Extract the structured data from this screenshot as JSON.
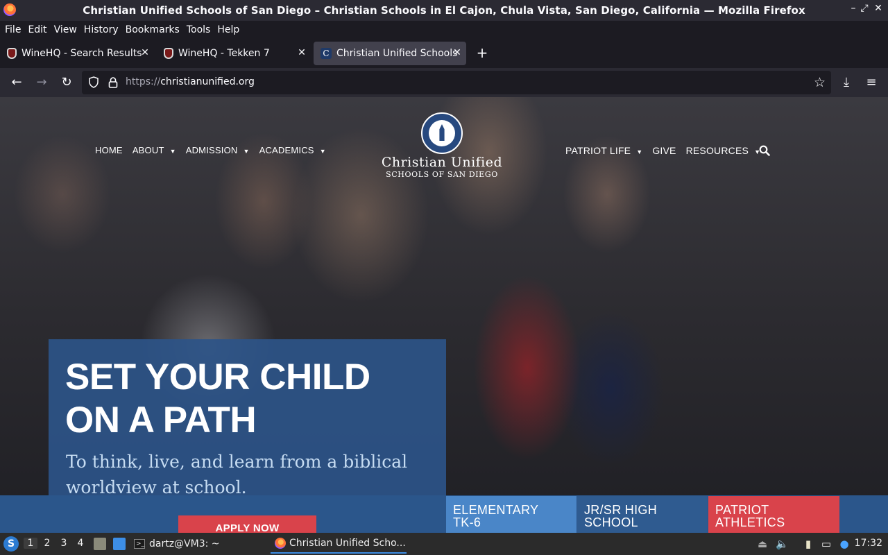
{
  "window": {
    "title": "Christian Unified Schools of San Diego – Christian Schools in El Cajon, Chula Vista, San Diego, California — Mozilla Firefox",
    "controls": [
      "–",
      "⤢",
      "✕"
    ]
  },
  "menubar": [
    "File",
    "Edit",
    "View",
    "History",
    "Bookmarks",
    "Tools",
    "Help"
  ],
  "tabs": [
    {
      "label": "WineHQ - Search Results",
      "favicon": "wine-glass-icon",
      "active": false
    },
    {
      "label": "WineHQ - Tekken 7",
      "favicon": "wine-glass-icon",
      "active": false
    },
    {
      "label": "Christian Unified Schools",
      "favicon": "c-letter-icon",
      "active": true
    }
  ],
  "newtab": "+",
  "nav": {
    "url_scheme": "https://",
    "url_host": "christianunified.org"
  },
  "site": {
    "nav_left": [
      "HOME",
      "ABOUT",
      "ADMISSION",
      "ACADEMICS"
    ],
    "nav_right": [
      "PATRIOT LIFE",
      "GIVE",
      "RESOURCES"
    ],
    "logo_name": "Christian Unified",
    "logo_sub": "SCHOOLS OF SAN DIEGO",
    "hero_title_line1": "SET YOUR CHILD",
    "hero_title_line2": "ON A PATH",
    "hero_subtitle": "To think, live, and learn from a biblical worldview at school.",
    "apply_button": "APPLY NOW",
    "tiles": [
      {
        "line1": "ELEMENTARY",
        "line2": "TK-6"
      },
      {
        "line1": "JR/SR HIGH",
        "line2": "SCHOOL"
      },
      {
        "line1": "PATRIOT",
        "line2": "ATHLETICS"
      }
    ],
    "colors": {
      "hero_box": "#2c5488",
      "apply": "#d9434b",
      "tile_elementary": "#4a86c8",
      "tile_jrsr": "#2f5b90",
      "tile_athletics": "#d9434b"
    }
  },
  "taskbar": {
    "workspaces": [
      "1",
      "2",
      "3",
      "4"
    ],
    "terminal_task": "dartz@VM3: ~",
    "firefox_task": "Christian Unified Scho...",
    "clock": "17:32"
  }
}
